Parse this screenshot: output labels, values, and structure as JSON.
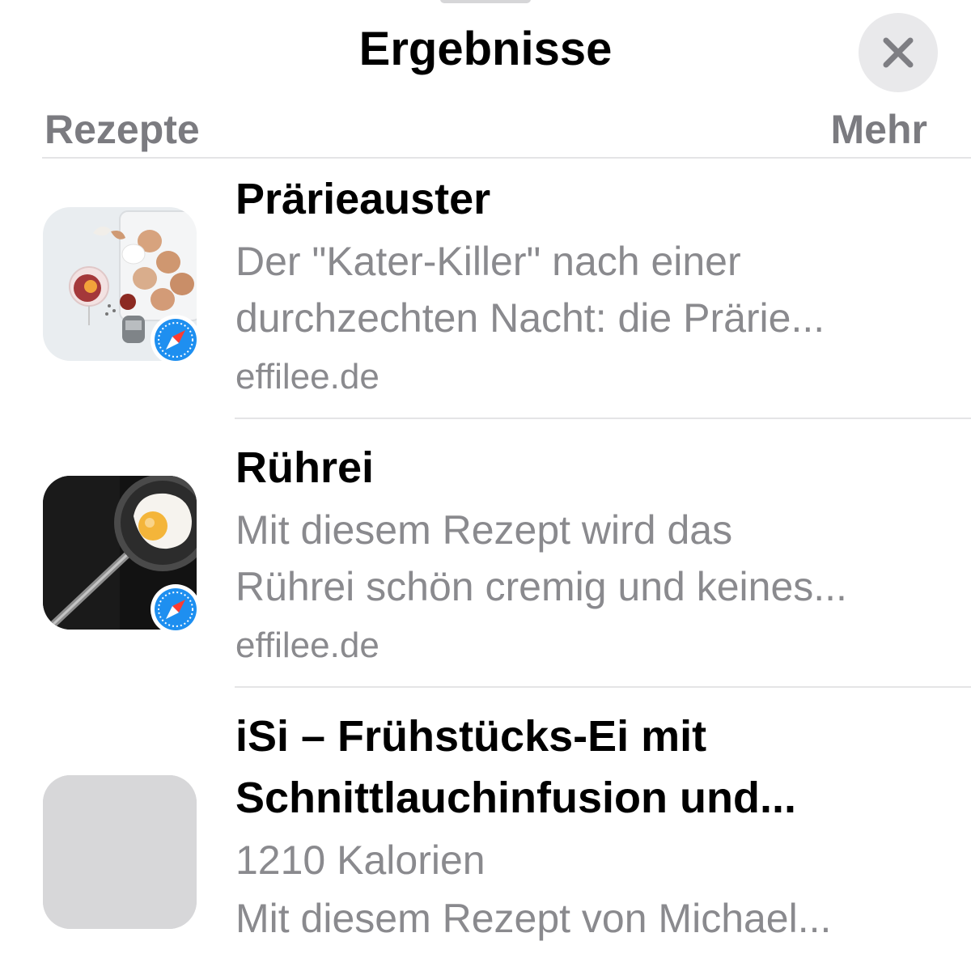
{
  "sheet": {
    "title": "Ergebnisse",
    "close_icon": "close-icon"
  },
  "section": {
    "label": "Rezepte",
    "more_label": "Mehr"
  },
  "results": [
    {
      "title": "Prärieauster",
      "desc_line1": "Der \"Kater-Killer\" nach einer",
      "desc_line2": "durchzechten Nacht: die Prärie...",
      "source": "effilee.de",
      "thumbnail": "eggs-and-cocktail-photo",
      "badge_icon": "safari-compass-icon"
    },
    {
      "title": "Rührei",
      "desc_line1": "Mit diesem Rezept wird das",
      "desc_line2": "Rührei schön cremig und keines...",
      "source": "effilee.de",
      "thumbnail": "fried-egg-pan-photo",
      "badge_icon": "safari-compass-icon"
    },
    {
      "title_line1": "iSi – Frühstücks-Ei mit",
      "title_line2": "Schnittlauchinfusion und...",
      "calories": "1210 Kalorien",
      "desc_line1": "Mit diesem Rezept von Michael...",
      "thumbnail": "placeholder-thumbnail"
    }
  ],
  "colors": {
    "title_text": "#000000",
    "secondary_text": "#8a8a8e",
    "section_label": "#7b7b80",
    "close_button_bg": "#e9e9eb",
    "divider": "#e4e4e6",
    "safari_blue": "#1e8ff0"
  }
}
